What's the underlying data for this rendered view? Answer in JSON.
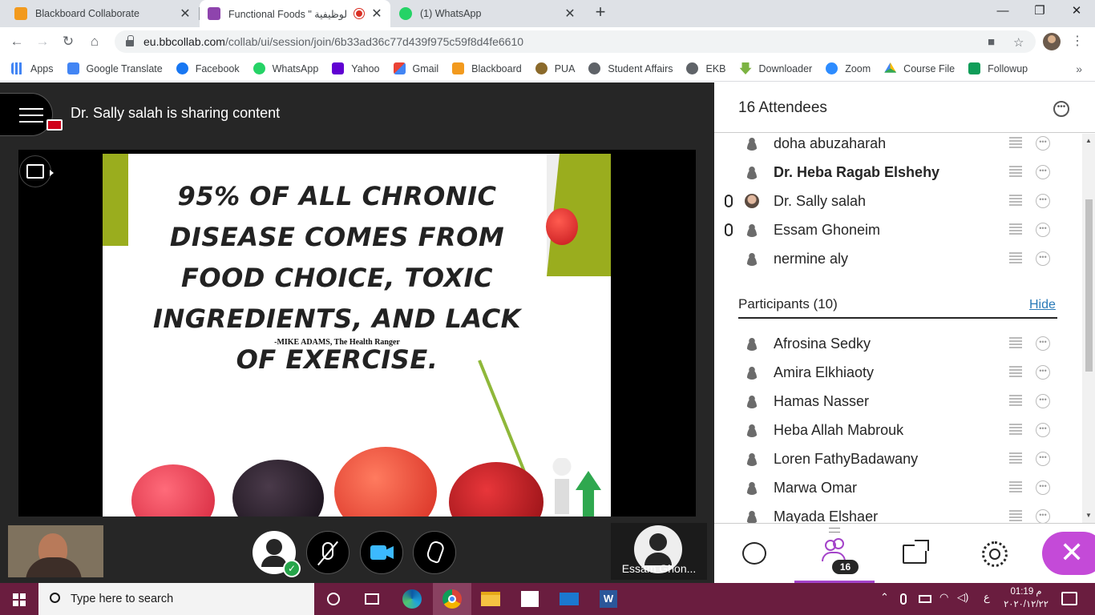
{
  "browser": {
    "tabs": [
      {
        "label": "Blackboard Collaborate",
        "icon": "blackboard-icon",
        "active": false
      },
      {
        "label": "Functional Foods \" الوظيفية",
        "icon": "collaborate-icon",
        "active": true,
        "recording": true
      },
      {
        "label": "(1) WhatsApp",
        "icon": "whatsapp-icon",
        "active": false
      }
    ],
    "new_tab_symbol": "+",
    "window_controls": {
      "minimize": "—",
      "restore": "❐",
      "close": "✕"
    },
    "url_host": "eu.bbcollab.com",
    "url_path": "/collab/ui/session/join/6b33ad36c77d439f975c59f8d4fe6610",
    "bookmarks": [
      "Apps",
      "Google Translate",
      "Facebook",
      "WhatsApp",
      "Yahoo",
      "Gmail",
      "Blackboard",
      "PUA",
      "Student Affairs",
      "EKB",
      "Downloader",
      "Zoom",
      "Course File",
      "Followup"
    ],
    "bookmarks_more": "»"
  },
  "collab": {
    "share_title": "Dr. Sally salah is sharing content",
    "slide": {
      "quote": "95% OF ALL CHRONIC DISEASE COMES FROM FOOD CHOICE, TOXIC INGREDIENTS, AND LACK OF EXERCISE.",
      "credit": "-MIKE ADAMS, The Health Ranger"
    },
    "camera_tile_name": "Essam Ghon...",
    "accent_color": "#a443c9"
  },
  "panel": {
    "title": "16 Attendees",
    "moderators": [
      {
        "name": "doha abuzaharah",
        "bold": false,
        "mic": false,
        "photo": false
      },
      {
        "name": "Dr. Heba Ragab Elshehy",
        "bold": true,
        "mic": false,
        "photo": false
      },
      {
        "name": "Dr. Sally salah",
        "bold": false,
        "mic": true,
        "photo": true
      },
      {
        "name": "Essam Ghoneim",
        "bold": false,
        "mic": true,
        "photo": false
      },
      {
        "name": "nermine aly",
        "bold": false,
        "mic": false,
        "photo": false
      }
    ],
    "participants_title": "Participants (10)",
    "participants_toggle": "Hide",
    "participants": [
      {
        "name": "Afrosina Sedky"
      },
      {
        "name": "Amira Elkhiaoty"
      },
      {
        "name": "Hamas Nasser"
      },
      {
        "name": "Heba Allah Mabrouk"
      },
      {
        "name": "Loren FathyBadawany"
      },
      {
        "name": "Marwa Omar"
      },
      {
        "name": "Mayada Elshaer"
      }
    ],
    "attendee_count_badge": "16"
  },
  "taskbar": {
    "search_placeholder": "Type here to search",
    "time": "01:19 م",
    "date": "٢٠٢٠/١٢/٢٢",
    "lang": "ع"
  }
}
